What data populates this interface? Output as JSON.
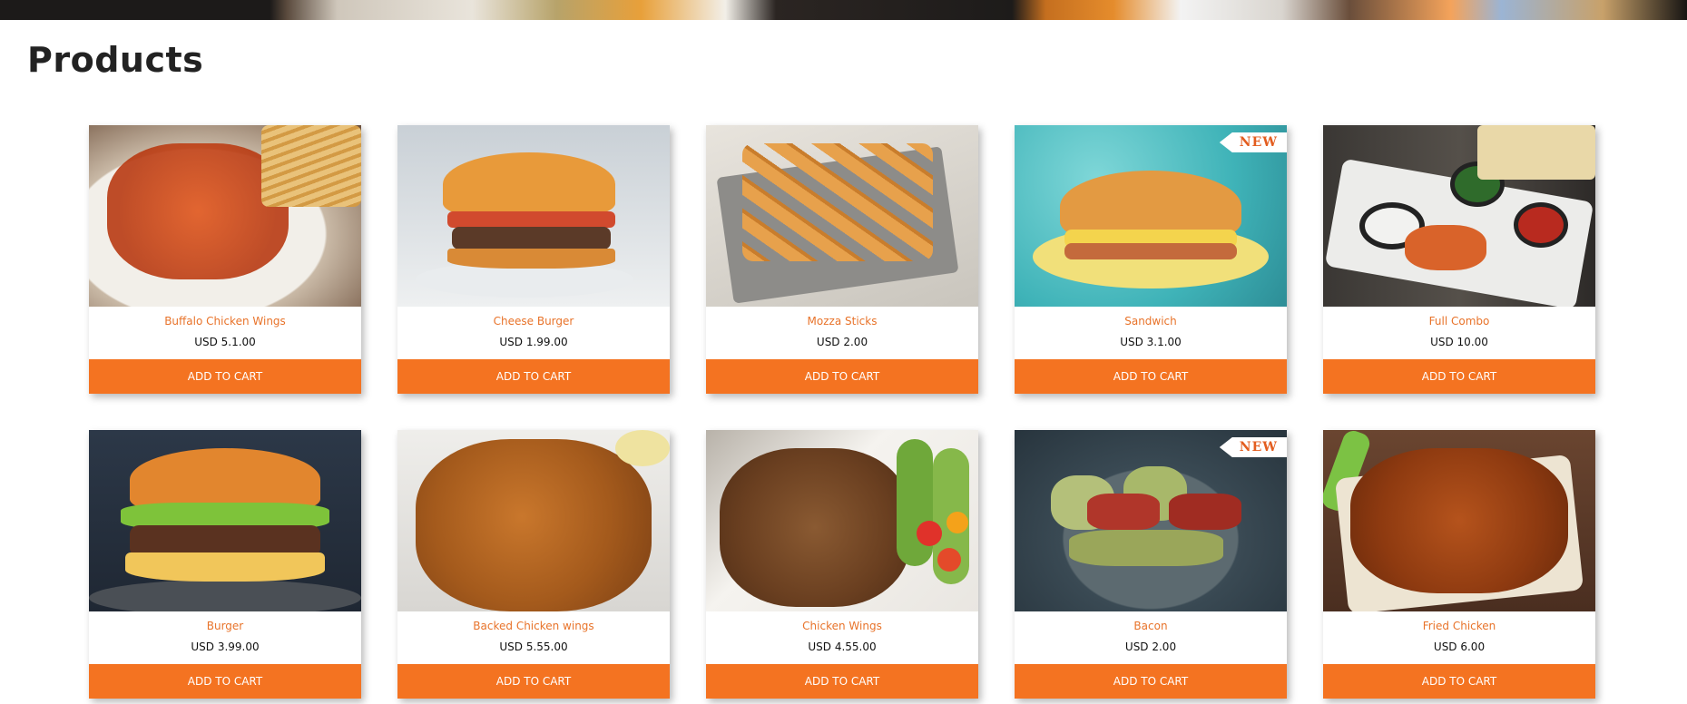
{
  "page": {
    "title": "Products"
  },
  "colors": {
    "accent": "#f47321",
    "product_name": "#e8732a",
    "badge_text": "#e35d1f"
  },
  "products": [
    {
      "name": "Buffalo Chicken Wings",
      "price": "USD 5.1.00",
      "button": "ADD TO CART",
      "badge": ""
    },
    {
      "name": "Cheese Burger",
      "price": "USD 1.99.00",
      "button": "ADD TO CART",
      "badge": ""
    },
    {
      "name": "Mozza Sticks",
      "price": "USD 2.00",
      "button": "ADD TO CART",
      "badge": ""
    },
    {
      "name": "Sandwich",
      "price": "USD 3.1.00",
      "button": "ADD TO CART",
      "badge": "NEW"
    },
    {
      "name": "Full Combo",
      "price": "USD 10.00",
      "button": "ADD TO CART",
      "badge": ""
    },
    {
      "name": "Burger",
      "price": "USD 3.99.00",
      "button": "ADD TO CART",
      "badge": ""
    },
    {
      "name": "Backed Chicken wings",
      "price": "USD 5.55.00",
      "button": "ADD TO CART",
      "badge": ""
    },
    {
      "name": "Chicken Wings",
      "price": "USD 4.55.00",
      "button": "ADD TO CART",
      "badge": ""
    },
    {
      "name": "Bacon",
      "price": "USD 2.00",
      "button": "ADD TO CART",
      "badge": "NEW"
    },
    {
      "name": "Fried Chicken",
      "price": "USD 6.00",
      "button": "ADD TO CART",
      "badge": ""
    }
  ]
}
